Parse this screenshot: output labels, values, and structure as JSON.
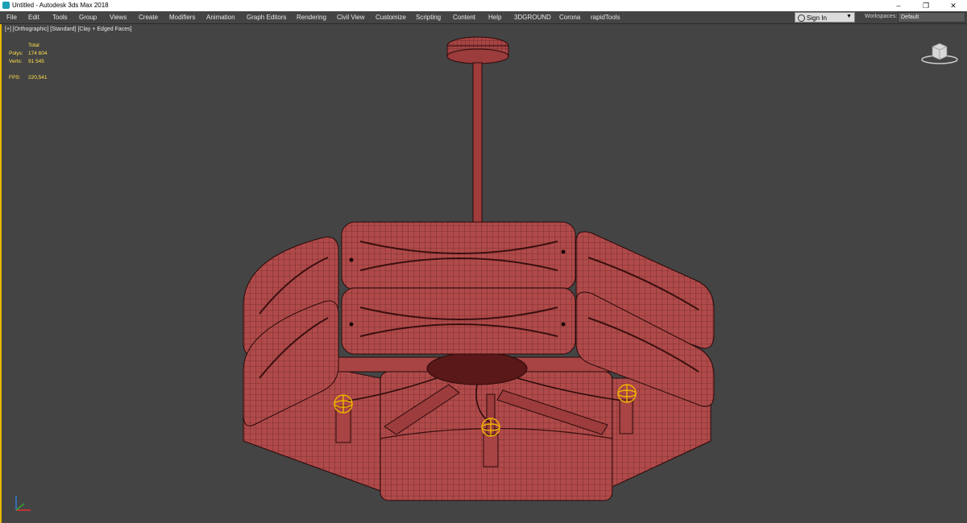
{
  "window": {
    "title": "Untitled - Autodesk 3ds Max 2018",
    "controls": {
      "minimize": "–",
      "restore": "❐",
      "close": "✕"
    }
  },
  "menu": {
    "items": [
      "File",
      "Edit",
      "Tools",
      "Group",
      "Views",
      "Create",
      "Modifiers",
      "Animation",
      "Graph Editors",
      "Rendering",
      "Civil View",
      "Customize",
      "Scripting",
      "Content",
      "Help",
      "3DGROUND",
      "Corona",
      "rapidTools"
    ]
  },
  "account": {
    "sign_in": "Sign In",
    "caret": "▼"
  },
  "workspaces": {
    "label": "Workspaces:",
    "value": "Default"
  },
  "viewport": {
    "label": "[+] [Orthographic] [Standard] [Clay + Edged Faces]",
    "stats": {
      "header": "Total",
      "rows": [
        {
          "key": "Polys:",
          "value": "174 604"
        },
        {
          "key": "Verts:",
          "value": "91 545"
        },
        {
          "key": "FPS:",
          "value": "220,541"
        }
      ]
    }
  },
  "colors": {
    "model_fill": "#b04a4a",
    "model_wire": "#3a0f0f",
    "selection_light": "#f0b400",
    "viewport_bg": "#444444"
  },
  "icons": [
    "app-icon",
    "user-icon",
    "viewcube-icon",
    "axis-gizmo-icon",
    "light-helper-icon"
  ]
}
